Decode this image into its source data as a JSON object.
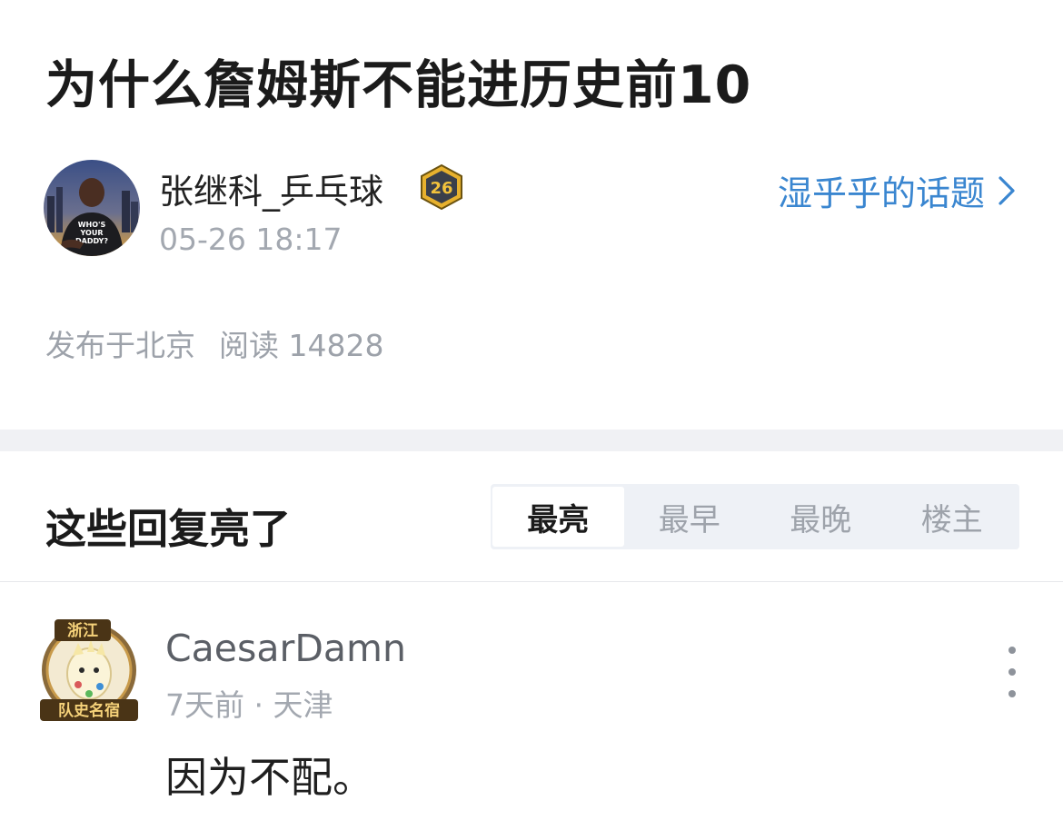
{
  "post": {
    "title": "为什么詹姆斯不能进历史前10",
    "author": {
      "name": "张继科_乒乓球",
      "avatar_icon": "author-avatar-photo",
      "badge_icon": "level-badge-icon",
      "badge_text": "26",
      "time": "05-26 18:17"
    },
    "topic": {
      "label": "湿乎乎的话题",
      "icon": "chevron-right-icon",
      "color": "#3a86d0"
    },
    "meta": {
      "location": "发布于北京",
      "reads": "阅读 14828"
    }
  },
  "replies": {
    "title": "这些回复亮了",
    "tabs": [
      {
        "label": "最亮",
        "active": true
      },
      {
        "label": "最早",
        "active": false
      },
      {
        "label": "最晚",
        "active": false
      },
      {
        "label": "楼主",
        "active": false
      }
    ],
    "comments": [
      {
        "user": "CaesarDamn",
        "avatar_icon": "team-badge-avatar",
        "avatar_top_text": "浙江",
        "avatar_bottom_text": "队史名宿",
        "meta": "7天前 · 天津",
        "body": "因为不配。",
        "more_icon": "more-vertical-icon"
      }
    ]
  }
}
